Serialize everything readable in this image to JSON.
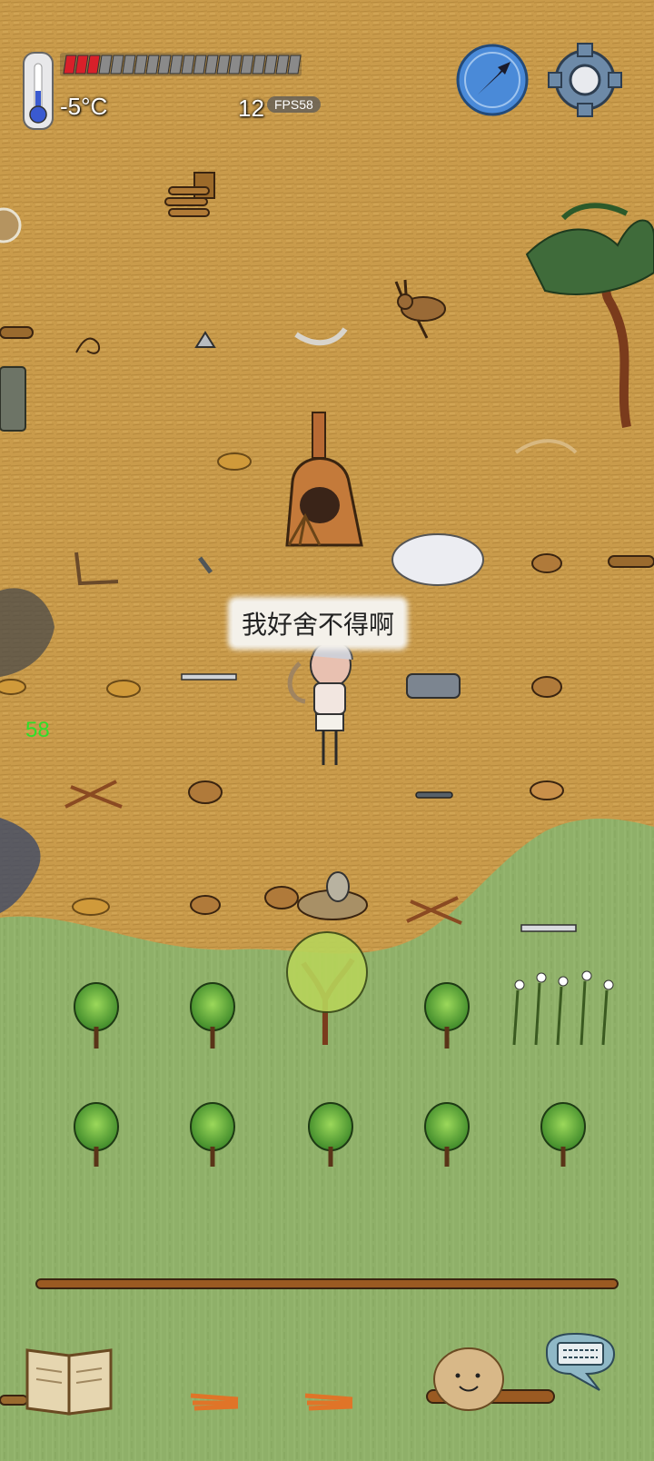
{
  "hud": {
    "temperature": "-5°C",
    "age": "12",
    "fps_badge": "FPS58",
    "fps_debug": "58",
    "food_pips_filled": 3,
    "food_pips_total": 20
  },
  "character": {
    "speech": "我好舍不得啊"
  },
  "icons": {
    "compass": "compass-icon",
    "settings": "gear-icon",
    "recipe_book": "book-icon",
    "emote": "potato-face-icon",
    "keyboard": "keyboard-chat-icon"
  },
  "colors": {
    "food_red": "#d8202a",
    "ground_dry": "#c89a4a",
    "ground_grass": "#8fb069",
    "debug_green": "#2ee02a"
  }
}
